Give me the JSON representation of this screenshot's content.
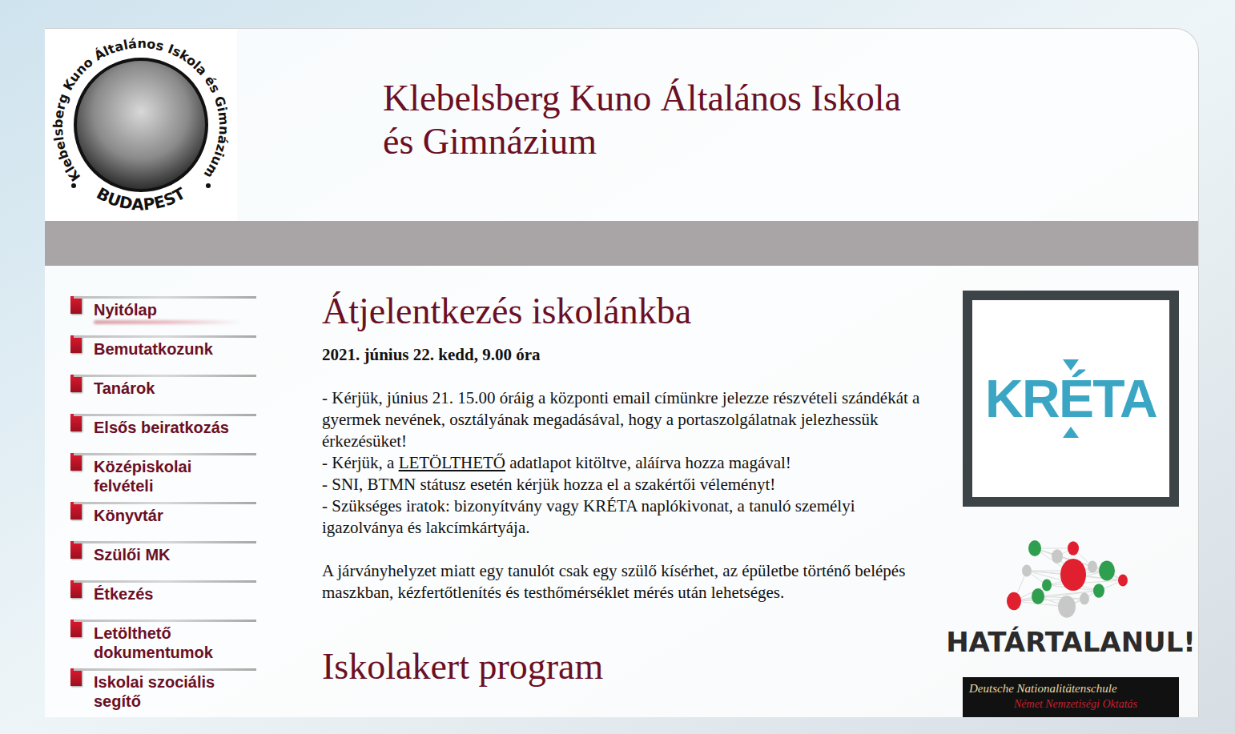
{
  "school": {
    "name_line1": "Klebelsberg Kuno Általános Iskola",
    "name_line2": "és Gimnázium",
    "logo": {
      "ring_text": "Klebelsberg Kuno Általános Iskola és Gimnázium",
      "city": "BUDAPEST"
    }
  },
  "menu": [
    {
      "label": "Nyitólap",
      "selected": true
    },
    {
      "label": "Bemutatkozunk",
      "selected": false
    },
    {
      "label": "Tanárok",
      "selected": false
    },
    {
      "label": "Elsős beiratkozás",
      "selected": false
    },
    {
      "label": "Középiskolai felvételi",
      "selected": false
    },
    {
      "label": "Könyvtár",
      "selected": false
    },
    {
      "label": "Szülői MK",
      "selected": false
    },
    {
      "label": "Étkezés",
      "selected": false
    },
    {
      "label": "Letölthető dokumentumok",
      "selected": false
    },
    {
      "label": "Iskolai szociális segítő",
      "selected": false
    }
  ],
  "article": {
    "title": "Átjelentkezés iskolánkba",
    "date": "2021. június 22. kedd, 9.00 óra",
    "items": [
      [
        {
          "text": "- Kérjük, június 21. 15.00 óráig a központi email címünkre jelezze részvételi szándékát a gyermek nevének, osztályának megadásával, hogy a portaszolgálatnak jelezhessük érkezésüket!",
          "link": false
        }
      ],
      [
        {
          "text": "- Kérjük, a ",
          "link": false
        },
        {
          "text": "LETÖLTHETŐ",
          "link": true
        },
        {
          "text": " adatlapot kitöltve, aláírva hozza magával!",
          "link": false
        }
      ],
      [
        {
          "text": "- SNI, BTMN státusz esetén kérjük hozza el a szakértői véleményt!",
          "link": false
        }
      ],
      [
        {
          "text": "- Szükséges iratok: bizonyítvány vagy KRÉTA naplókivonat, a tanuló személyi igazolványa és lakcímkártyája.",
          "link": false
        }
      ]
    ],
    "note": "A járványhelyzet miatt egy tanulót csak egy szülő kísérhet, az épületbe történő belépés maszkban, kézfertőtlenítés és testhőmérséklet mérés után lehetséges."
  },
  "next_article": {
    "title": "Iskolakert program"
  },
  "banners": {
    "kreta": "KRÉTA",
    "hatartalanul": "HATÁRTALANUL!",
    "german": {
      "line1": "Deutsche Nationalitätenschule",
      "line2": "Német Nemzetiségi Oktatás"
    }
  }
}
